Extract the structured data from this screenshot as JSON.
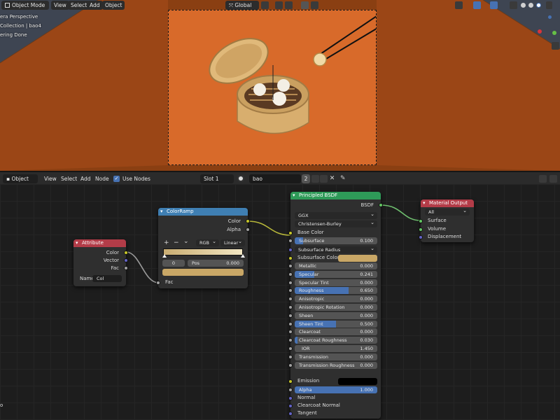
{
  "viewport": {
    "mode_label": "Object Mode",
    "menus": [
      "View",
      "Select",
      "Add",
      "Object"
    ],
    "transform_orientation": "Global",
    "overlay_lines": [
      "era Perspective",
      "Collection | bao4",
      "ering Done"
    ]
  },
  "node_header": {
    "editor_type": "Object",
    "menus": [
      "View",
      "Select",
      "Add",
      "Node"
    ],
    "use_nodes_label": "Use Nodes",
    "use_nodes_checked": true,
    "slot": "Slot 1",
    "material_name": "bao",
    "user_count": "2"
  },
  "nodes": {
    "attribute": {
      "title": "Attribute",
      "outputs": [
        "Color",
        "Vector",
        "Fac"
      ],
      "name_label": "Name",
      "name_value": "Col"
    },
    "colorramp": {
      "title": "ColorRamp",
      "outputs": [
        "Color",
        "Alpha"
      ],
      "controls": {
        "add": "+",
        "remove": "−",
        "menu": "⌄"
      },
      "color_mode": "RGB",
      "interpolation": "Linear",
      "stop_index": "0",
      "pos_label": "Pos",
      "pos_value": "0.000",
      "input": "Fac"
    },
    "bsdf": {
      "title": "Principled BSDF",
      "output": "BSDF",
      "distribution": "GGX",
      "subsurface_method": "Christensen-Burley",
      "base_color_label": "Base Color",
      "subsurface_radius_label": "Subsurface Radius",
      "subsurface_color_label": "Subsurface Color",
      "params": [
        {
          "label": "Subsurface",
          "value": "0.100",
          "fill": 0.1
        },
        {
          "label": "Metallic",
          "value": "0.000",
          "fill": 0.0
        },
        {
          "label": "Specular",
          "value": "0.241",
          "fill": 0.241
        },
        {
          "label": "Specular Tint",
          "value": "0.000",
          "fill": 0.0
        },
        {
          "label": "Roughness",
          "value": "0.650",
          "fill": 0.65
        },
        {
          "label": "Anisotropic",
          "value": "0.000",
          "fill": 0.0
        },
        {
          "label": "Anisotropic Rotation",
          "value": "0.000",
          "fill": 0.0
        },
        {
          "label": "Sheen",
          "value": "0.000",
          "fill": 0.0
        },
        {
          "label": "Sheen Tint",
          "value": "0.500",
          "fill": 0.5
        },
        {
          "label": "Clearcoat",
          "value": "0.000",
          "fill": 0.0
        },
        {
          "label": "Clearcoat Roughness",
          "value": "0.030",
          "fill": 0.03
        },
        {
          "label": "IOR",
          "value": "1.450",
          "fill": 0.0
        },
        {
          "label": "Transmission",
          "value": "0.000",
          "fill": 0.0
        },
        {
          "label": "Transmission Roughness",
          "value": "0.000",
          "fill": 0.0
        }
      ],
      "emission_label": "Emission",
      "alpha_label": "Alpha",
      "alpha_value": "1.000",
      "inputs_bottom": [
        "Normal",
        "Clearcoat Normal",
        "Tangent"
      ]
    },
    "output": {
      "title": "Material Output",
      "target": "All",
      "inputs": [
        "Surface",
        "Volume",
        "Displacement"
      ]
    }
  },
  "colors": {
    "attribute_header": "#b33c48",
    "colorramp_header": "#3f7fb3",
    "bsdf_header": "#2e9a58",
    "output_header": "#b33c48",
    "accent_blue": "#4772b3",
    "subsurface_color": "#c9a766",
    "ramp_start": "#c9ad72",
    "ramp_end": "#f2e6c2"
  }
}
